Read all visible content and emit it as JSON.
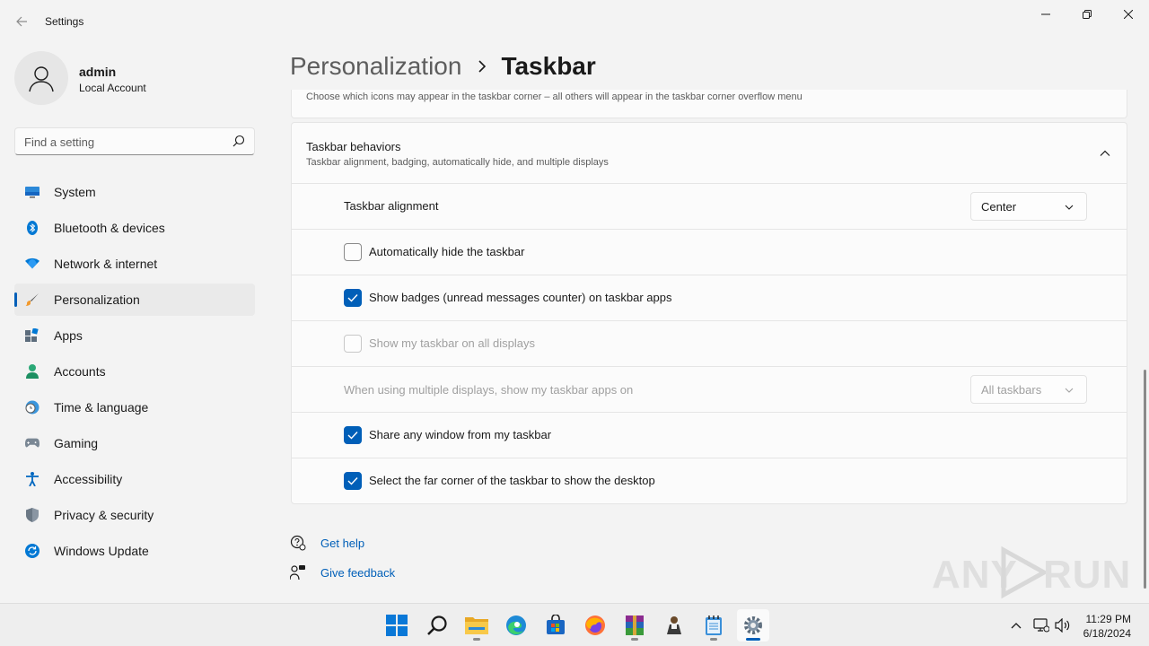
{
  "window": {
    "title": "Settings"
  },
  "profile": {
    "name": "admin",
    "account_type": "Local Account"
  },
  "search": {
    "placeholder": "Find a setting"
  },
  "nav": {
    "items": [
      {
        "label": "System",
        "icon": "monitor-icon",
        "active": false
      },
      {
        "label": "Bluetooth & devices",
        "icon": "bluetooth-icon",
        "active": false
      },
      {
        "label": "Network & internet",
        "icon": "wifi-icon",
        "active": false
      },
      {
        "label": "Personalization",
        "icon": "brush-icon",
        "active": true
      },
      {
        "label": "Apps",
        "icon": "apps-icon",
        "active": false
      },
      {
        "label": "Accounts",
        "icon": "person-icon",
        "active": false
      },
      {
        "label": "Time & language",
        "icon": "clock-globe-icon",
        "active": false
      },
      {
        "label": "Gaming",
        "icon": "gamepad-icon",
        "active": false
      },
      {
        "label": "Accessibility",
        "icon": "accessibility-icon",
        "active": false
      },
      {
        "label": "Privacy & security",
        "icon": "shield-icon",
        "active": false
      },
      {
        "label": "Windows Update",
        "icon": "update-icon",
        "active": false
      }
    ]
  },
  "header": {
    "parent": "Personalization",
    "current": "Taskbar"
  },
  "corner_overflow": {
    "description": "Choose which icons may appear in the taskbar corner – all others will appear in the taskbar corner overflow menu"
  },
  "behaviors": {
    "title": "Taskbar behaviors",
    "description": "Taskbar alignment, badging, automatically hide, and multiple displays",
    "alignment_label": "Taskbar alignment",
    "alignment_value": "Center",
    "auto_hide_label": "Automatically hide the taskbar",
    "auto_hide_checked": false,
    "badges_label": "Show badges (unread messages counter) on taskbar apps",
    "badges_checked": true,
    "all_displays_label": "Show my taskbar on all displays",
    "all_displays_checked": false,
    "multi_display_label": "When using multiple displays, show my taskbar apps on",
    "multi_display_value": "All taskbars",
    "share_window_label": "Share any window from my taskbar",
    "share_window_checked": true,
    "far_corner_label": "Select the far corner of the taskbar to show the desktop",
    "far_corner_checked": true
  },
  "links": {
    "help": "Get help",
    "feedback": "Give feedback"
  },
  "watermark": {
    "text_left": "ANY",
    "text_right": "RUN"
  },
  "taskbar": {
    "apps": [
      "start-icon",
      "search-icon",
      "file-explorer-icon",
      "edge-icon",
      "store-icon",
      "firefox-icon",
      "winrar-icon",
      "person-app-icon",
      "notepad-icon",
      "settings-icon"
    ],
    "time": "11:29 PM",
    "date": "6/18/2024"
  },
  "colors": {
    "accent": "#005fb8",
    "background": "#f3f3f3",
    "card": "#fbfbfb"
  }
}
